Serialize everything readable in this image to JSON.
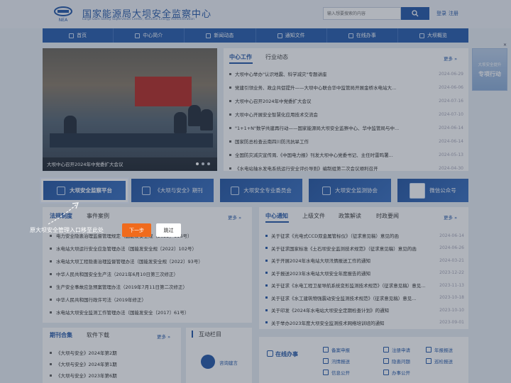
{
  "header": {
    "title_cn": "国家能源局大坝安全监察中心",
    "title_en": "Large Dam Safety Supervision Center, National Energy Administration",
    "logo_text": "NEA",
    "search_placeholder": "输入想要搜索的内容",
    "login": "登录",
    "register": "注册"
  },
  "nav": [
    "首页",
    "中心简介",
    "新闻动态",
    "通知文件",
    "在线办事",
    "大坝概览"
  ],
  "hero": {
    "caption": "大坝中心召开2024年中党委扩大会议"
  },
  "news": {
    "tabs": [
      "中心工作",
      "行业动态"
    ],
    "more": "更多",
    "items": [
      {
        "title": "大坝中心举办\"认识地震、科学减灾\"专题讲座",
        "date": "2024-06-29"
      },
      {
        "title": "党建引领业务、政企共促提升——大坝中心联合华中监管局开展金桥水电站大...",
        "date": "2024-06-06"
      },
      {
        "title": "大坝中心召开2024年中党委扩大会议",
        "date": "2024-07-16"
      },
      {
        "title": "大坝中心开展安全智慧化应用技术交流会",
        "date": "2024-07-10"
      },
      {
        "title": "\"1+1+N\"数学共建再行动——国家能源局大坝安全监察中心、华中监管局与中...",
        "date": "2024-06-14"
      },
      {
        "title": "国家防总检查云南四川防汛抗旱工作",
        "date": "2024-06-14"
      },
      {
        "title": "全国防灾减灾宣传周,《中国电力报》刊发大坝中心党委书记、主任时雷鸣署...",
        "date": "2024-05-13"
      },
      {
        "title": "《水电站轴水发电系统运行安全评价导则》编制组第二次会议顺利召开",
        "date": "2024-04-30"
      }
    ]
  },
  "quick_links": [
    "大坝安全监察平台",
    "《大坝与安全》期刊",
    "大坝安全专业委员会",
    "大坝安全监测协会",
    "微信公众号"
  ],
  "policy": {
    "tabs": [
      "法规制度",
      "事件案例"
    ],
    "more": "更多",
    "items": [
      "电力安全隐患治理监督管理规定（国能发安全规〔2022〕116号）",
      "水电站大坝运行安全应急管理办法（国能发安全规〔2022〕102号）",
      "水电站大坝工程隐患治理监督管理办法（国能发安全规〔2022〕93号）",
      "中华人民共和国安全生产法（2021年6月10日第三次修正）",
      "生产安全事故应急预案管理办法（2019年7月11日第二次修正）",
      "中华人民共和国行政许可法（2019年修正）",
      "水电站大坝安全监测工作管理办法（国能发安全〔2017〕61号）"
    ]
  },
  "notices": {
    "tabs": [
      "中心通知",
      "上级文件",
      "政策解读",
      "时政要闻"
    ],
    "more": "更多",
    "items": [
      {
        "title": "关于征求《光电式CCD双金属管标仪》（征求意见稿）意见的函",
        "date": "2024-06-14"
      },
      {
        "title": "关于征求国家标准《土石坝安全监测技术规范》（征求意见稿）意见的函",
        "date": "2024-06-26"
      },
      {
        "title": "关于开展2024年水电站大坝汛情报送工作的通知",
        "date": "2024-03-21"
      },
      {
        "title": "关于报送2023年水电站大坝安全年度报告的通知",
        "date": "2023-12-22"
      },
      {
        "title": "关于征求《水电工程卫星导航系统变形监测技术规范》（征求意见稿）意见...",
        "date": "2023-11-13"
      },
      {
        "title": "关于征求《水工建筑物强震动安全监测技术规范》（征求意见稿）意见...",
        "date": "2023-10-18"
      },
      {
        "title": "关于印发《2024年水电站大坝安全定期检查计划》的通知",
        "date": "2023-10-10"
      },
      {
        "title": "关于举办2023年度大坝安全监测技术网络培训班的通知",
        "date": "2023-09-01"
      }
    ]
  },
  "journal": {
    "tabs": [
      "期刊合集",
      "软件下载"
    ],
    "more": "更多",
    "items": [
      "《大坝与安全》2024年第2期",
      "《大坝与安全》2024年第1期",
      "《大坝与安全》2023年第6期"
    ]
  },
  "interact": {
    "title": "互动栏目",
    "consult": "咨询建言"
  },
  "online": {
    "title": "在线办事",
    "services": [
      "备案申报",
      "注册申请",
      "年报报送",
      "汛情报送",
      "隐患问题",
      "巡检报送",
      "信息公开",
      "办事公开"
    ]
  },
  "float_ad": {
    "line1": "大坝安全提升",
    "line2": "专项行动"
  },
  "tour": {
    "message": "原大坝安全管理入口移至此处",
    "next": "下一步",
    "skip": "跳过"
  }
}
